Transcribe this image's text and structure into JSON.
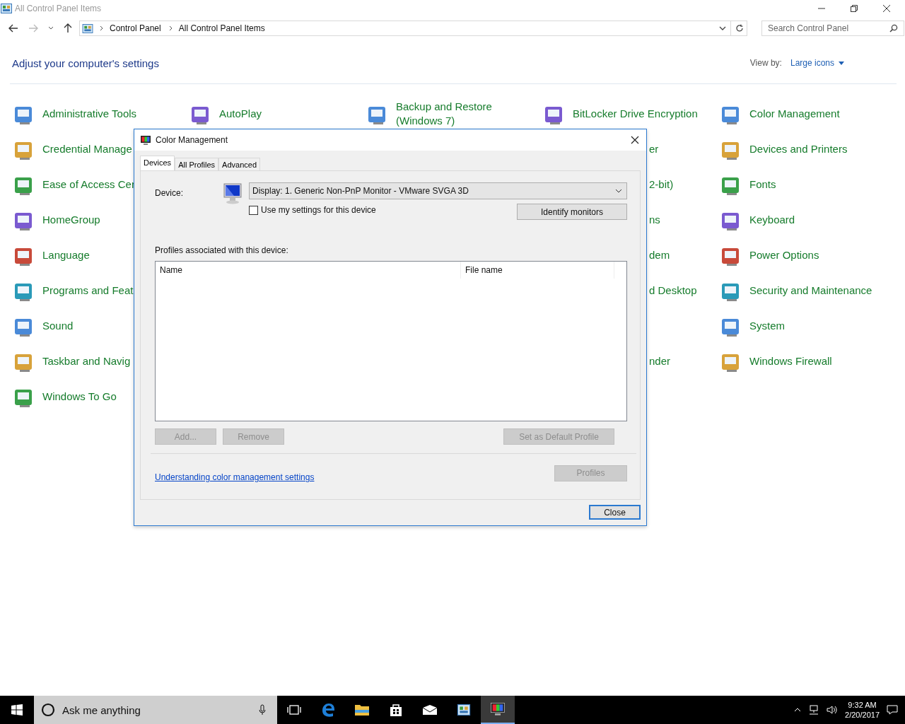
{
  "window": {
    "title": "All Control Panel Items"
  },
  "address_bar": {
    "breadcrumbs": [
      "Control Panel",
      "All Control Panel Items"
    ]
  },
  "search": {
    "placeholder": "Search Control Panel"
  },
  "heading": "Adjust your computer's settings",
  "view_by": {
    "label": "View by:",
    "value": "Large icons"
  },
  "columns": [
    [
      {
        "kind": "item",
        "label": "Administrative Tools"
      },
      {
        "kind": "item",
        "label": "Credential Manage"
      },
      {
        "kind": "item",
        "label": "Ease of Access Cer"
      },
      {
        "kind": "item",
        "label": "HomeGroup"
      },
      {
        "kind": "item",
        "label": "Language"
      },
      {
        "kind": "item",
        "label": "Programs and Feat"
      },
      {
        "kind": "item",
        "label": "Sound"
      },
      {
        "kind": "item",
        "label": "Taskbar and Navig"
      },
      {
        "kind": "item",
        "label": "Windows To Go"
      }
    ],
    [
      {
        "kind": "item",
        "label": "AutoPlay"
      }
    ],
    [
      {
        "kind": "item",
        "label": "Backup and Restore (Windows 7)"
      }
    ],
    [
      {
        "kind": "item",
        "label": "BitLocker Drive Encryption"
      },
      {
        "kind": "fragment",
        "label": "er"
      },
      {
        "kind": "fragment",
        "label": "2-bit)"
      },
      {
        "kind": "fragment",
        "label": "ns"
      },
      {
        "kind": "fragment",
        "label": "dem"
      },
      {
        "kind": "fragment",
        "label": "d Desktop"
      },
      {
        "kind": "blank"
      },
      {
        "kind": "fragment",
        "label": "nder"
      }
    ],
    [
      {
        "kind": "item",
        "label": "Color Management"
      },
      {
        "kind": "item",
        "label": "Devices and Printers"
      },
      {
        "kind": "item",
        "label": "Fonts"
      },
      {
        "kind": "item",
        "label": "Keyboard"
      },
      {
        "kind": "item",
        "label": "Power Options"
      },
      {
        "kind": "item",
        "label": "Security and Maintenance"
      },
      {
        "kind": "item",
        "label": "System"
      },
      {
        "kind": "item",
        "label": "Windows Firewall"
      }
    ]
  ],
  "dialog": {
    "title": "Color Management",
    "tabs": [
      {
        "label": "Devices",
        "selected": true
      },
      {
        "label": "All Profiles",
        "selected": false
      },
      {
        "label": "Advanced",
        "selected": false
      }
    ],
    "device_label": "Device:",
    "device_value": "Display: 1. Generic Non-PnP Monitor - VMware SVGA 3D",
    "use_my_settings": {
      "label": "Use my settings for this device",
      "checked": false
    },
    "identify_button": {
      "label": "Identify monitors",
      "disabled": false
    },
    "profiles_label": "Profiles associated with this device:",
    "columns": [
      "Name",
      "File name"
    ],
    "list_buttons": [
      {
        "label": "Add...",
        "disabled": true
      },
      {
        "label": "Remove",
        "disabled": true
      },
      {
        "label": "Set as Default Profile",
        "disabled": true
      }
    ],
    "link": "Understanding color management settings",
    "profiles_button": {
      "label": "Profiles",
      "disabled": true
    },
    "close_button": {
      "label": "Close",
      "disabled": false
    }
  },
  "taskbar": {
    "search_placeholder": "Ask me anything",
    "apps": [
      {
        "kind": "taskview",
        "selected": false
      },
      {
        "kind": "edge",
        "selected": false
      },
      {
        "kind": "explorer",
        "selected": false
      },
      {
        "kind": "store",
        "selected": false
      },
      {
        "kind": "mail",
        "selected": false
      },
      {
        "kind": "controlpanel",
        "selected": false
      },
      {
        "kind": "colormgmt",
        "selected": true
      }
    ],
    "time": "9:32 AM",
    "date": "2/20/2017"
  }
}
